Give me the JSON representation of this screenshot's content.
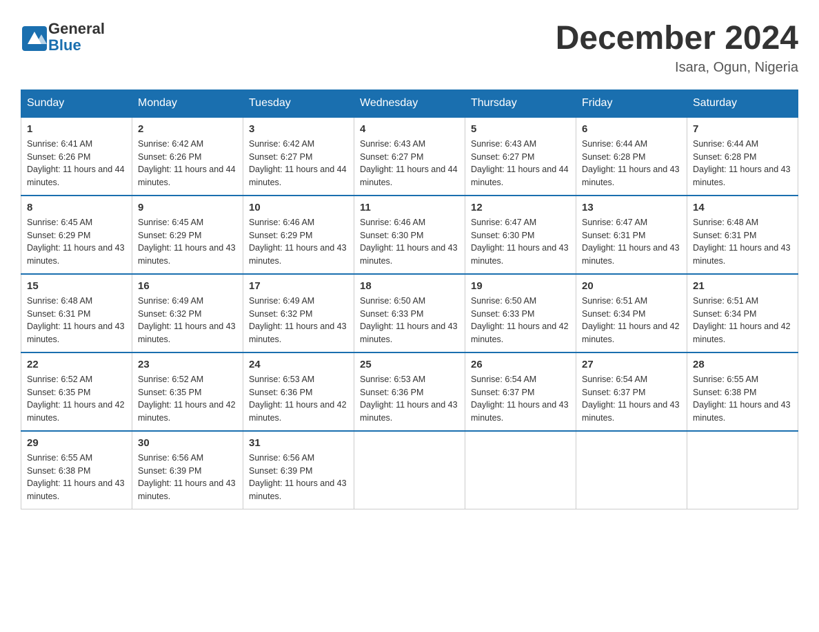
{
  "logo": {
    "text_general": "General",
    "text_blue": "Blue"
  },
  "title": "December 2024",
  "location": "Isara, Ogun, Nigeria",
  "days_of_week": [
    "Sunday",
    "Monday",
    "Tuesday",
    "Wednesday",
    "Thursday",
    "Friday",
    "Saturday"
  ],
  "weeks": [
    [
      {
        "day": "1",
        "sunrise": "6:41 AM",
        "sunset": "6:26 PM",
        "daylight": "11 hours and 44 minutes."
      },
      {
        "day": "2",
        "sunrise": "6:42 AM",
        "sunset": "6:26 PM",
        "daylight": "11 hours and 44 minutes."
      },
      {
        "day": "3",
        "sunrise": "6:42 AM",
        "sunset": "6:27 PM",
        "daylight": "11 hours and 44 minutes."
      },
      {
        "day": "4",
        "sunrise": "6:43 AM",
        "sunset": "6:27 PM",
        "daylight": "11 hours and 44 minutes."
      },
      {
        "day": "5",
        "sunrise": "6:43 AM",
        "sunset": "6:27 PM",
        "daylight": "11 hours and 44 minutes."
      },
      {
        "day": "6",
        "sunrise": "6:44 AM",
        "sunset": "6:28 PM",
        "daylight": "11 hours and 43 minutes."
      },
      {
        "day": "7",
        "sunrise": "6:44 AM",
        "sunset": "6:28 PM",
        "daylight": "11 hours and 43 minutes."
      }
    ],
    [
      {
        "day": "8",
        "sunrise": "6:45 AM",
        "sunset": "6:29 PM",
        "daylight": "11 hours and 43 minutes."
      },
      {
        "day": "9",
        "sunrise": "6:45 AM",
        "sunset": "6:29 PM",
        "daylight": "11 hours and 43 minutes."
      },
      {
        "day": "10",
        "sunrise": "6:46 AM",
        "sunset": "6:29 PM",
        "daylight": "11 hours and 43 minutes."
      },
      {
        "day": "11",
        "sunrise": "6:46 AM",
        "sunset": "6:30 PM",
        "daylight": "11 hours and 43 minutes."
      },
      {
        "day": "12",
        "sunrise": "6:47 AM",
        "sunset": "6:30 PM",
        "daylight": "11 hours and 43 minutes."
      },
      {
        "day": "13",
        "sunrise": "6:47 AM",
        "sunset": "6:31 PM",
        "daylight": "11 hours and 43 minutes."
      },
      {
        "day": "14",
        "sunrise": "6:48 AM",
        "sunset": "6:31 PM",
        "daylight": "11 hours and 43 minutes."
      }
    ],
    [
      {
        "day": "15",
        "sunrise": "6:48 AM",
        "sunset": "6:31 PM",
        "daylight": "11 hours and 43 minutes."
      },
      {
        "day": "16",
        "sunrise": "6:49 AM",
        "sunset": "6:32 PM",
        "daylight": "11 hours and 43 minutes."
      },
      {
        "day": "17",
        "sunrise": "6:49 AM",
        "sunset": "6:32 PM",
        "daylight": "11 hours and 43 minutes."
      },
      {
        "day": "18",
        "sunrise": "6:50 AM",
        "sunset": "6:33 PM",
        "daylight": "11 hours and 43 minutes."
      },
      {
        "day": "19",
        "sunrise": "6:50 AM",
        "sunset": "6:33 PM",
        "daylight": "11 hours and 42 minutes."
      },
      {
        "day": "20",
        "sunrise": "6:51 AM",
        "sunset": "6:34 PM",
        "daylight": "11 hours and 42 minutes."
      },
      {
        "day": "21",
        "sunrise": "6:51 AM",
        "sunset": "6:34 PM",
        "daylight": "11 hours and 42 minutes."
      }
    ],
    [
      {
        "day": "22",
        "sunrise": "6:52 AM",
        "sunset": "6:35 PM",
        "daylight": "11 hours and 42 minutes."
      },
      {
        "day": "23",
        "sunrise": "6:52 AM",
        "sunset": "6:35 PM",
        "daylight": "11 hours and 42 minutes."
      },
      {
        "day": "24",
        "sunrise": "6:53 AM",
        "sunset": "6:36 PM",
        "daylight": "11 hours and 42 minutes."
      },
      {
        "day": "25",
        "sunrise": "6:53 AM",
        "sunset": "6:36 PM",
        "daylight": "11 hours and 43 minutes."
      },
      {
        "day": "26",
        "sunrise": "6:54 AM",
        "sunset": "6:37 PM",
        "daylight": "11 hours and 43 minutes."
      },
      {
        "day": "27",
        "sunrise": "6:54 AM",
        "sunset": "6:37 PM",
        "daylight": "11 hours and 43 minutes."
      },
      {
        "day": "28",
        "sunrise": "6:55 AM",
        "sunset": "6:38 PM",
        "daylight": "11 hours and 43 minutes."
      }
    ],
    [
      {
        "day": "29",
        "sunrise": "6:55 AM",
        "sunset": "6:38 PM",
        "daylight": "11 hours and 43 minutes."
      },
      {
        "day": "30",
        "sunrise": "6:56 AM",
        "sunset": "6:39 PM",
        "daylight": "11 hours and 43 minutes."
      },
      {
        "day": "31",
        "sunrise": "6:56 AM",
        "sunset": "6:39 PM",
        "daylight": "11 hours and 43 minutes."
      },
      null,
      null,
      null,
      null
    ]
  ]
}
